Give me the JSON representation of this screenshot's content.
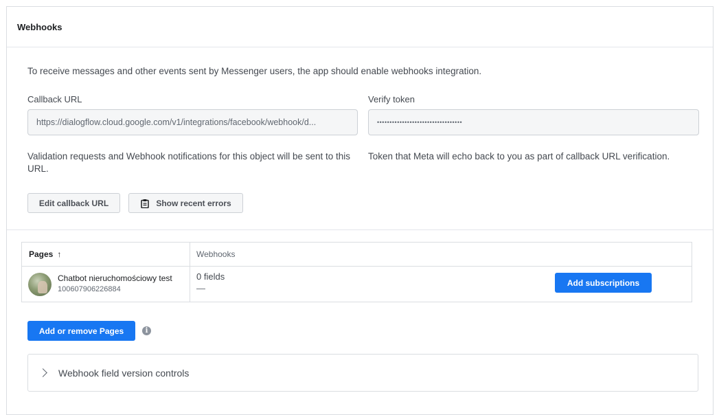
{
  "panel": {
    "title": "Webhooks"
  },
  "intro_text": "To receive messages and other events sent by Messenger users, the app should enable webhooks integration.",
  "callback": {
    "label": "Callback URL",
    "value": "https://dialogflow.cloud.google.com/v1/integrations/facebook/webhook/d...",
    "help": "Validation requests and Webhook notifications for this object will be sent to this URL."
  },
  "verify": {
    "label": "Verify token",
    "value": "••••••••••••••••••••••••••••••••••",
    "help": "Token that Meta will echo back to you as part of callback URL verification."
  },
  "buttons": {
    "edit_callback": "Edit callback URL",
    "show_errors": "Show recent errors",
    "add_subscriptions": "Add subscriptions",
    "add_remove_pages": "Add or remove Pages"
  },
  "table": {
    "headers": {
      "pages": "Pages",
      "pages_sort": "↑",
      "webhooks": "Webhooks"
    },
    "rows": [
      {
        "page_name": "Chatbot nieruchomościowy test",
        "page_id": "100607906226884",
        "fields": "0 fields",
        "fields_detail": "—"
      }
    ]
  },
  "info_icon_glyph": "i",
  "accordion": {
    "label": "Webhook field version controls"
  },
  "colors": {
    "primary": "#1877f2",
    "border": "#dadde1"
  }
}
